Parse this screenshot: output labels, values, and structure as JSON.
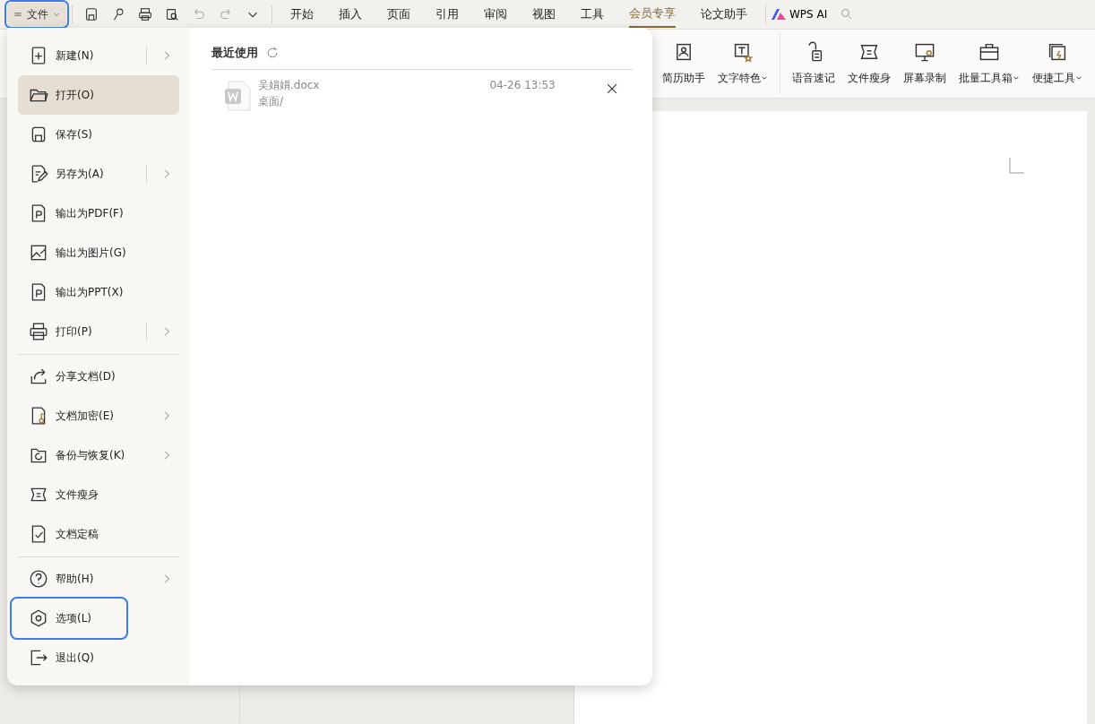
{
  "file_button": {
    "label": "文件",
    "highlighted": true
  },
  "tabs": [
    {
      "label": "开始",
      "selected": false
    },
    {
      "label": "插入",
      "selected": false
    },
    {
      "label": "页面",
      "selected": false
    },
    {
      "label": "引用",
      "selected": false
    },
    {
      "label": "审阅",
      "selected": false
    },
    {
      "label": "视图",
      "selected": false
    },
    {
      "label": "工具",
      "selected": false
    },
    {
      "label": "会员专享",
      "selected": true
    },
    {
      "label": "论文助手",
      "selected": false
    }
  ],
  "ai_button": {
    "label": "WPS AI"
  },
  "ribbon": [
    {
      "label": "简历助手",
      "dropdown": false,
      "divider_after": false
    },
    {
      "label": "文字特色",
      "dropdown": true,
      "divider_after": true
    },
    {
      "label": "语音速记",
      "dropdown": false,
      "divider_after": false
    },
    {
      "label": "文件瘦身",
      "dropdown": false,
      "divider_after": false
    },
    {
      "label": "屏幕录制",
      "dropdown": false,
      "divider_after": false
    },
    {
      "label": "批量工具箱",
      "dropdown": true,
      "divider_after": false
    },
    {
      "label": "便捷工具",
      "dropdown": true,
      "divider_after": false
    }
  ],
  "file_menu": {
    "items": [
      {
        "label": "新建(N)",
        "submenu": true,
        "split": true,
        "selected": false,
        "highlighted": false,
        "divider_after": false
      },
      {
        "label": "打开(O)",
        "submenu": false,
        "split": false,
        "selected": true,
        "highlighted": false,
        "divider_after": false
      },
      {
        "label": "保存(S)",
        "submenu": false,
        "split": false,
        "selected": false,
        "highlighted": false,
        "divider_after": false
      },
      {
        "label": "另存为(A)",
        "submenu": true,
        "split": true,
        "selected": false,
        "highlighted": false,
        "divider_after": false
      },
      {
        "label": "输出为PDF(F)",
        "submenu": false,
        "split": false,
        "selected": false,
        "highlighted": false,
        "divider_after": false
      },
      {
        "label": "输出为图片(G)",
        "submenu": false,
        "split": false,
        "selected": false,
        "highlighted": false,
        "divider_after": false
      },
      {
        "label": "输出为PPT(X)",
        "submenu": false,
        "split": false,
        "selected": false,
        "highlighted": false,
        "divider_after": false
      },
      {
        "label": "打印(P)",
        "submenu": true,
        "split": true,
        "selected": false,
        "highlighted": false,
        "divider_after": true
      },
      {
        "label": "分享文档(D)",
        "submenu": false,
        "split": false,
        "selected": false,
        "highlighted": false,
        "divider_after": false
      },
      {
        "label": "文档加密(E)",
        "submenu": true,
        "split": false,
        "selected": false,
        "highlighted": false,
        "divider_after": false
      },
      {
        "label": "备份与恢复(K)",
        "submenu": true,
        "split": false,
        "selected": false,
        "highlighted": false,
        "divider_after": false
      },
      {
        "label": "文件瘦身",
        "submenu": false,
        "split": false,
        "selected": false,
        "highlighted": false,
        "divider_after": false
      },
      {
        "label": "文档定稿",
        "submenu": false,
        "split": false,
        "selected": false,
        "highlighted": false,
        "divider_after": true
      },
      {
        "label": "帮助(H)",
        "submenu": true,
        "split": false,
        "selected": false,
        "highlighted": false,
        "divider_after": false
      },
      {
        "label": "选项(L)",
        "submenu": false,
        "split": false,
        "selected": false,
        "highlighted": true,
        "divider_after": false
      },
      {
        "label": "退出(Q)",
        "submenu": false,
        "split": false,
        "selected": false,
        "highlighted": false,
        "divider_after": false
      }
    ],
    "recent": {
      "title": "最近使用",
      "files": [
        {
          "name": "吴娟娟.docx",
          "location": "桌面/",
          "time": "04-26 13:53"
        }
      ]
    }
  }
}
